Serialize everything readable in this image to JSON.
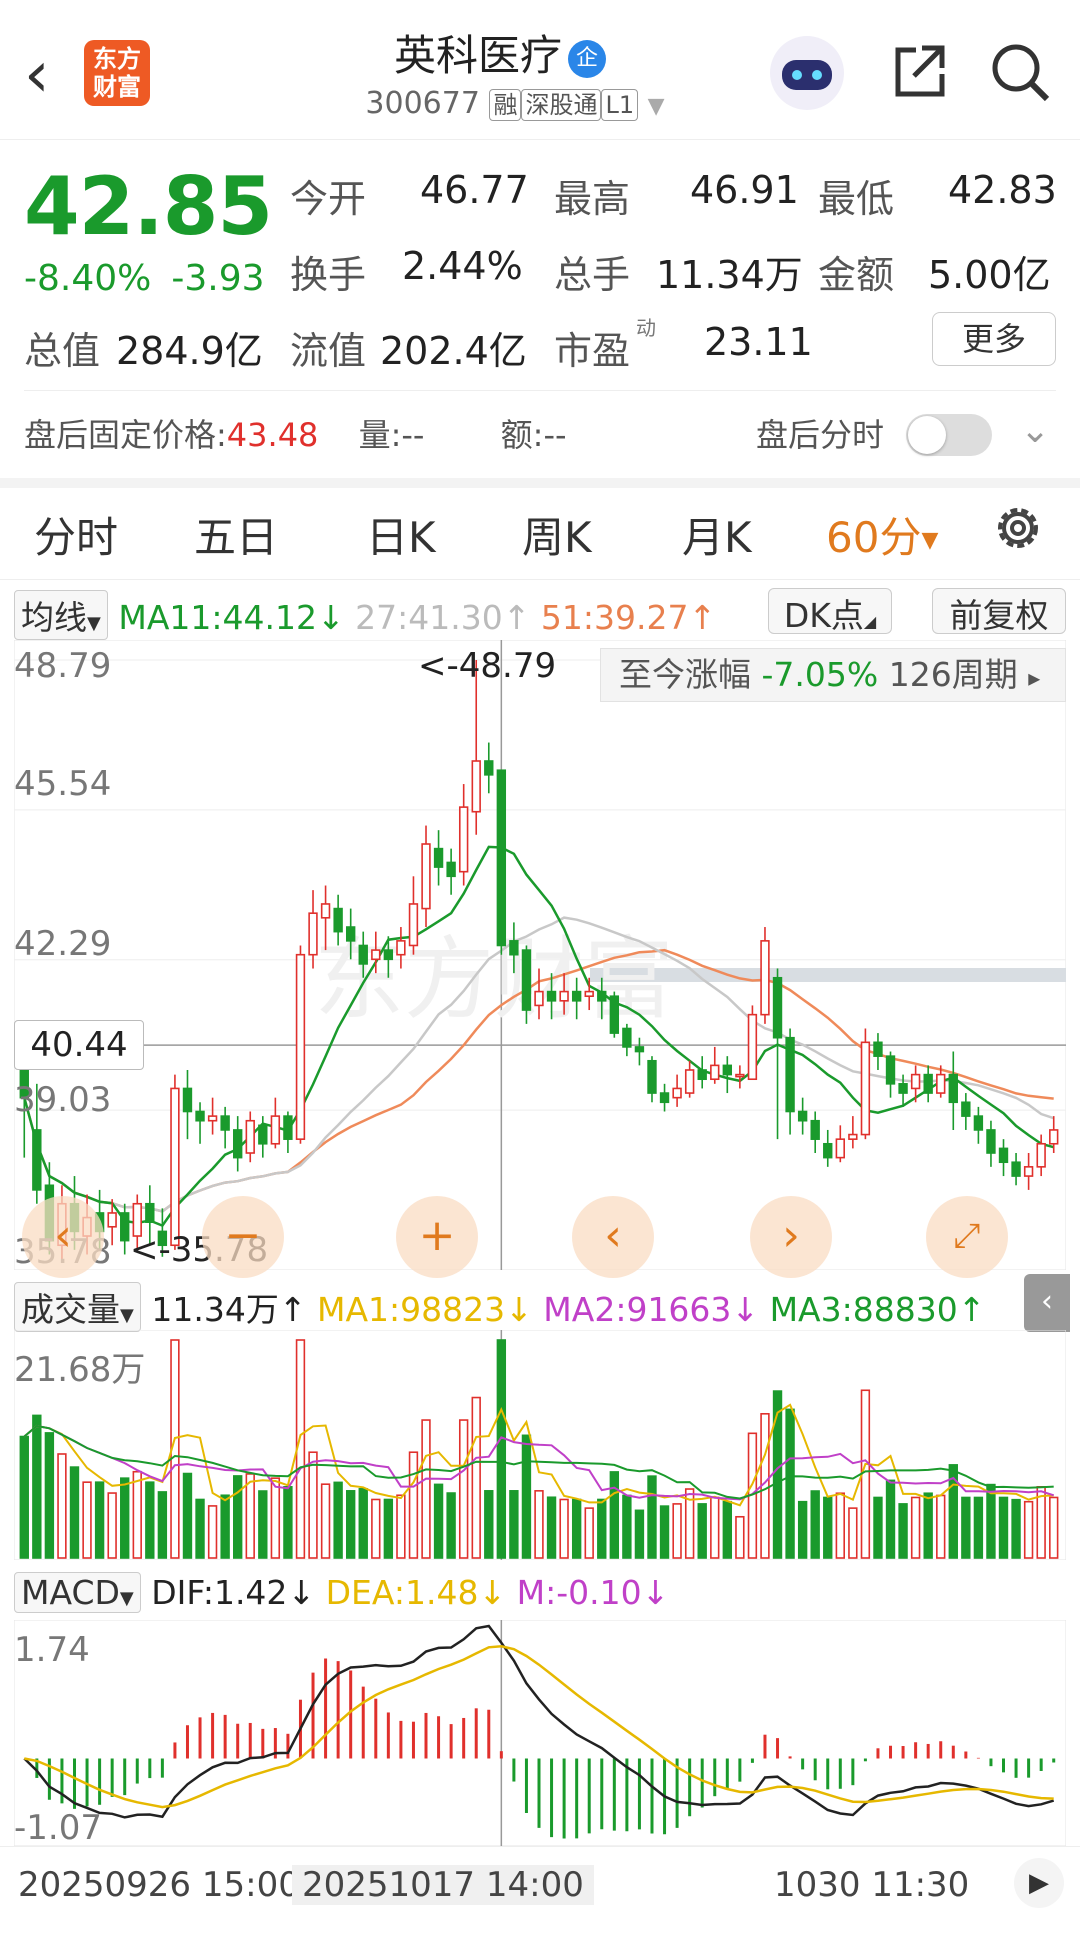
{
  "header": {
    "back_icon": "chevron-left-icon",
    "logo_text": "东方财富",
    "title": "英科医疗",
    "qi_badge": "企",
    "code": "300677",
    "tags": [
      "融",
      "深股通",
      "L1"
    ]
  },
  "quote": {
    "price": "42.85",
    "change_pct": "-8.40%",
    "change_abs": "-3.93",
    "open_label": "今开",
    "open": "46.77",
    "high_label": "最高",
    "high": "46.91",
    "low_label": "最低",
    "low": "42.83",
    "turnover_label": "换手",
    "turnover": "2.44%",
    "volume_label": "总手",
    "volume": "11.34万",
    "amount_label": "金额",
    "amount": "5.00亿",
    "total_cap_label": "总值",
    "total_cap": "284.9亿",
    "float_cap_label": "流值",
    "float_cap": "202.4亿",
    "pe_label": "市盈",
    "pe_sup": "动",
    "pe": "23.11",
    "more_label": "更多"
  },
  "after_hours": {
    "label": "盘后固定价格:",
    "price": "43.48",
    "vol_label": "量:",
    "vol": "--",
    "amt_label": "额:",
    "amt": "--",
    "intraday_label": "盘后分时"
  },
  "tabs": [
    "分时",
    "五日",
    "日K",
    "周K",
    "月K",
    "60分"
  ],
  "active_tab": 5,
  "kline": {
    "ma_selector": "均线",
    "ma11": "MA11:44.12",
    "ma_gray": "27:41.30",
    "ma_orange": "51:39.27",
    "dk_label": "DK点",
    "adjust_label": "前复权",
    "y_ticks": [
      "48.79",
      "45.54",
      "42.29",
      "39.03",
      "35.78"
    ],
    "high_marker": "<-48.79",
    "low_marker": "<-35.78",
    "cursor_price": "40.44",
    "period_label": "至今涨幅",
    "period_value": "-7.05%",
    "period_count": "126周期"
  },
  "volume": {
    "selector": "成交量",
    "value": "11.34万",
    "ma1": "MA1:98823",
    "ma2": "MA2:91663",
    "ma3": "MA3:88830",
    "y_max": "21.68万"
  },
  "macd": {
    "selector": "MACD",
    "dif": "DIF:1.42",
    "dea": "DEA:1.48",
    "m": "M:-0.10",
    "y_top": "1.74",
    "y_bottom": "-1.07"
  },
  "x_axis": [
    "20250926 15:00",
    "20251017 14:00",
    "1030 11:30"
  ],
  "colors": {
    "up": "#e0302c",
    "down": "#1a9a2c",
    "accent": "#e07a1e",
    "ma_green": "#1a9a2c",
    "ma_gray": "#c8c8c8",
    "ma_orange": "#ef8a5a"
  },
  "chart_data": {
    "type": "candlestick",
    "ylim": [
      35.78,
      48.79
    ],
    "candles": [
      [
        40.1,
        39.3,
        40.6,
        38.0
      ],
      [
        38.6,
        37.3,
        39.6,
        37.0
      ],
      [
        37.4,
        36.2,
        37.9,
        35.9
      ],
      [
        36.1,
        37.0,
        37.4,
        35.78
      ],
      [
        37.0,
        36.4,
        37.6,
        36.0
      ],
      [
        36.3,
        36.7,
        37.2,
        35.9
      ],
      [
        36.8,
        36.4,
        37.3,
        36.0
      ],
      [
        36.5,
        36.8,
        37.1,
        36.1
      ],
      [
        36.8,
        36.2,
        37.0,
        35.9
      ],
      [
        36.3,
        37.0,
        37.2,
        36.0
      ],
      [
        37.0,
        36.6,
        37.4,
        36.1
      ],
      [
        36.4,
        36.1,
        36.9,
        35.85
      ],
      [
        36.1,
        39.5,
        39.8,
        36.0
      ],
      [
        39.5,
        39.0,
        39.9,
        38.4
      ],
      [
        39.0,
        38.8,
        39.2,
        38.3
      ],
      [
        38.8,
        38.9,
        39.3,
        38.5
      ],
      [
        38.9,
        38.6,
        39.1,
        38.2
      ],
      [
        38.6,
        38.0,
        38.9,
        37.7
      ],
      [
        38.1,
        38.8,
        39.0,
        37.9
      ],
      [
        38.7,
        38.3,
        38.9,
        38.0
      ],
      [
        38.3,
        38.9,
        39.3,
        38.2
      ],
      [
        38.9,
        38.4,
        39.0,
        38.1
      ],
      [
        38.4,
        42.4,
        42.6,
        38.3
      ],
      [
        42.4,
        43.3,
        43.8,
        42.1
      ],
      [
        43.2,
        43.5,
        43.9,
        42.5
      ],
      [
        43.4,
        42.9,
        43.7,
        42.6
      ],
      [
        43.0,
        42.7,
        43.4,
        42.3
      ],
      [
        42.6,
        42.2,
        42.9,
        41.9
      ],
      [
        42.3,
        42.5,
        42.9,
        42.0
      ],
      [
        42.5,
        42.3,
        42.8,
        41.9
      ],
      [
        42.4,
        42.7,
        43.0,
        42.1
      ],
      [
        42.6,
        43.5,
        44.1,
        42.4
      ],
      [
        43.4,
        44.8,
        45.2,
        43.0
      ],
      [
        44.7,
        44.3,
        45.1,
        43.9
      ],
      [
        44.4,
        44.1,
        44.7,
        43.7
      ],
      [
        44.2,
        45.6,
        46.1,
        43.9
      ],
      [
        45.5,
        46.6,
        48.79,
        45.0
      ],
      [
        46.6,
        46.3,
        47.0,
        45.9
      ],
      [
        46.4,
        42.6,
        46.4,
        42.4
      ],
      [
        42.7,
        42.4,
        43.1,
        42.0
      ],
      [
        42.5,
        41.2,
        42.6,
        40.9
      ],
      [
        41.3,
        41.6,
        42.1,
        41.0
      ],
      [
        41.6,
        41.4,
        42.0,
        41.0
      ],
      [
        41.4,
        41.6,
        42.0,
        41.1
      ],
      [
        41.6,
        41.4,
        41.9,
        41.0
      ],
      [
        41.5,
        41.6,
        41.9,
        41.2
      ],
      [
        41.6,
        41.4,
        41.9,
        41.0
      ],
      [
        41.5,
        40.7,
        41.6,
        40.6
      ],
      [
        40.8,
        40.4,
        40.9,
        40.2
      ],
      [
        40.4,
        40.3,
        40.6,
        40.0
      ],
      [
        40.1,
        39.4,
        40.2,
        39.2
      ],
      [
        39.4,
        39.2,
        39.6,
        39.0
      ],
      [
        39.3,
        39.5,
        39.8,
        39.1
      ],
      [
        39.4,
        39.9,
        40.1,
        39.3
      ],
      [
        39.9,
        39.7,
        40.2,
        39.5
      ],
      [
        39.7,
        40.0,
        40.4,
        39.6
      ],
      [
        40.0,
        39.8,
        40.2,
        39.4
      ],
      [
        39.8,
        39.8,
        40.0,
        39.5
      ],
      [
        39.7,
        41.1,
        41.3,
        39.7
      ],
      [
        41.1,
        42.7,
        43.0,
        40.9
      ],
      [
        41.9,
        40.6,
        42.1,
        38.4
      ],
      [
        40.6,
        39.0,
        40.8,
        38.5
      ],
      [
        39.0,
        38.8,
        39.3,
        38.5
      ],
      [
        38.8,
        38.4,
        39.0,
        38.1
      ],
      [
        38.3,
        38.0,
        38.6,
        37.8
      ],
      [
        38.0,
        38.4,
        38.7,
        37.9
      ],
      [
        38.4,
        38.5,
        38.9,
        38.2
      ],
      [
        38.5,
        40.5,
        40.8,
        38.4
      ],
      [
        40.5,
        40.2,
        40.7,
        39.9
      ],
      [
        40.2,
        39.6,
        40.3,
        39.3
      ],
      [
        39.6,
        39.4,
        39.8,
        39.1
      ],
      [
        39.5,
        39.8,
        40.0,
        39.2
      ],
      [
        39.8,
        39.4,
        40.0,
        39.2
      ],
      [
        39.4,
        39.8,
        40.0,
        39.3
      ],
      [
        39.8,
        39.2,
        40.3,
        38.6
      ],
      [
        39.2,
        38.9,
        39.4,
        38.6
      ],
      [
        38.9,
        38.6,
        39.1,
        38.3
      ],
      [
        38.6,
        38.1,
        38.8,
        37.8
      ],
      [
        38.2,
        37.9,
        38.4,
        37.6
      ],
      [
        37.9,
        37.6,
        38.1,
        37.4
      ],
      [
        37.6,
        37.8,
        38.1,
        37.3
      ],
      [
        37.8,
        38.3,
        38.5,
        37.6
      ],
      [
        38.3,
        38.6,
        38.9,
        38.1
      ]
    ],
    "volume_ylim": [
      0,
      21.68
    ],
    "volume_unit": "万",
    "macd_ylim": [
      -1.07,
      1.74
    ]
  }
}
